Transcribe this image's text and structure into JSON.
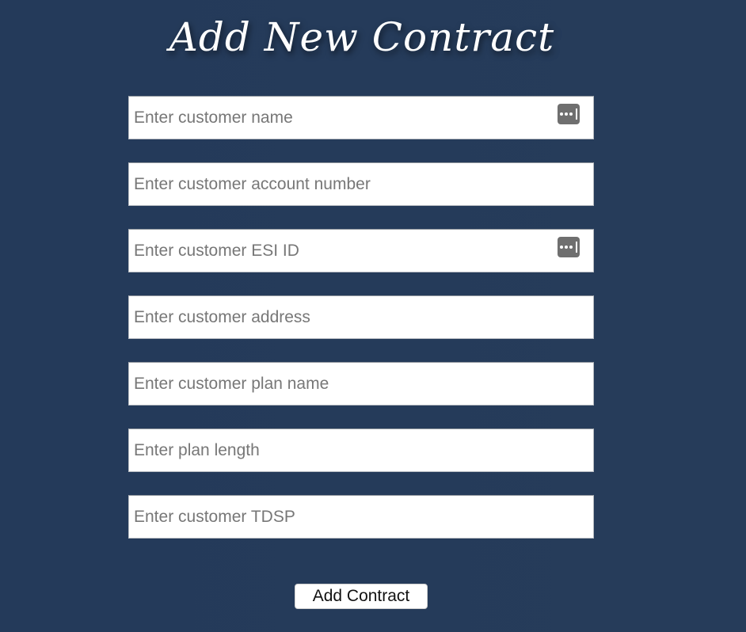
{
  "page": {
    "title": "Add New Contract"
  },
  "form": {
    "fields": [
      {
        "placeholder": "Enter customer name",
        "value": "",
        "autofill_icon": "autofill-key-icon"
      },
      {
        "placeholder": "Enter customer account number",
        "value": ""
      },
      {
        "placeholder": "Enter customer ESI ID",
        "value": "",
        "autofill_icon": "autofill-key-icon"
      },
      {
        "placeholder": "Enter customer address",
        "value": ""
      },
      {
        "placeholder": "Enter customer plan name",
        "value": ""
      },
      {
        "placeholder": "Enter plan length",
        "value": ""
      },
      {
        "placeholder": "Enter customer TDSP",
        "value": ""
      }
    ],
    "submit_label": "Add Contract"
  },
  "colors": {
    "background": "#243a5a",
    "title_text": "#ffffff",
    "input_background": "#ffffff",
    "placeholder_text": "#777777",
    "autofill_icon": "#6f6f6f"
  }
}
